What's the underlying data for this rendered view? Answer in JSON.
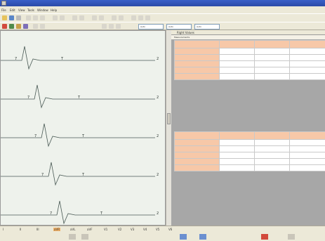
{
  "app": {
    "colors": {
      "header_cell": "#f7c8a8",
      "grid_background": "#a7a7a7",
      "trace_background": "#eef2ec",
      "selected_lead": "#f3b46a"
    }
  },
  "menu": {
    "items": [
      "File",
      "Edit",
      "View",
      "Tools",
      "Window",
      "Help"
    ]
  },
  "toolbar2": {
    "selects": [
      "Auto",
      "Auto",
      "Auto"
    ]
  },
  "ecg": {
    "traces": [
      {
        "marker_a": "7",
        "marker_b": "T",
        "right_marker": "2"
      },
      {
        "marker_a": "7",
        "marker_b": "T",
        "right_marker": "2"
      },
      {
        "marker_a": "7",
        "marker_b": "T",
        "right_marker": "2"
      },
      {
        "marker_a": "7",
        "marker_b": "T",
        "right_marker": "2"
      },
      {
        "marker_a": "7",
        "marker_b": "T",
        "right_marker": "2"
      }
    ]
  },
  "panel": {
    "header": "Right Values",
    "tab": "Measurements",
    "table1": {
      "headers": [
        "",
        "",
        "",
        ""
      ],
      "rows": [
        {
          "label": "",
          "values": [
            "",
            "",
            ""
          ]
        },
        {
          "label": "",
          "values": [
            "",
            "",
            ""
          ]
        },
        {
          "label": "",
          "values": [
            "",
            "",
            ""
          ]
        },
        {
          "label": "",
          "values": [
            "",
            "",
            ""
          ]
        },
        {
          "label": "",
          "values": [
            "",
            "",
            ""
          ]
        }
      ]
    },
    "table2": {
      "headers": [
        "",
        "",
        "",
        ""
      ],
      "rows": [
        {
          "label": "",
          "values": [
            "",
            "",
            ""
          ]
        },
        {
          "label": "",
          "values": [
            "",
            "",
            ""
          ]
        },
        {
          "label": "",
          "values": [
            "",
            "",
            ""
          ]
        },
        {
          "label": "",
          "values": [
            "",
            "",
            ""
          ]
        },
        {
          "label": "",
          "values": [
            "",
            "",
            ""
          ]
        }
      ]
    }
  },
  "status": {
    "leads": [
      "I",
      "II",
      "III",
      "aVR",
      "aVL",
      "aVF",
      "V1",
      "V2",
      "V3",
      "V4",
      "V5",
      "V6"
    ],
    "selected_lead": "aVR"
  }
}
